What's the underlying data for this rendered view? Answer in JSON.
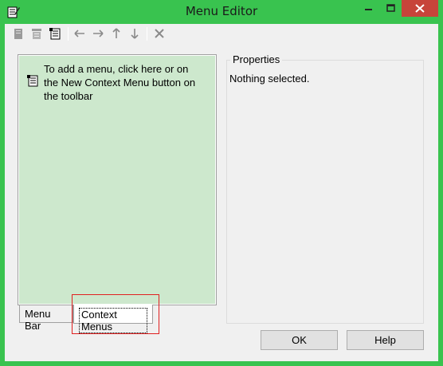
{
  "window": {
    "title": "Menu Editor",
    "title_bar_color": "#39c34f",
    "close_color": "#c7443a"
  },
  "toolbar": {
    "buttons": [
      {
        "name": "new-menu-icon",
        "enabled": false
      },
      {
        "name": "new-menubar-icon",
        "enabled": false
      },
      {
        "name": "new-context-menu-icon",
        "enabled": true
      },
      {
        "name": "arrow-left-icon",
        "enabled": false
      },
      {
        "name": "arrow-right-icon",
        "enabled": false
      },
      {
        "name": "arrow-up-icon",
        "enabled": false
      },
      {
        "name": "arrow-down-icon",
        "enabled": false
      },
      {
        "name": "delete-icon",
        "enabled": false
      }
    ]
  },
  "menu_panel": {
    "hint": "To add a menu, click here or on the New Context Menu button on the toolbar",
    "background": "#cde8cd"
  },
  "tabs": {
    "menu_bar": "Menu Bar",
    "context_menus": "Context Menus",
    "active": "context_menus"
  },
  "properties": {
    "title": "Properties",
    "text": "Nothing selected."
  },
  "buttons": {
    "ok": "OK",
    "help": "Help"
  }
}
